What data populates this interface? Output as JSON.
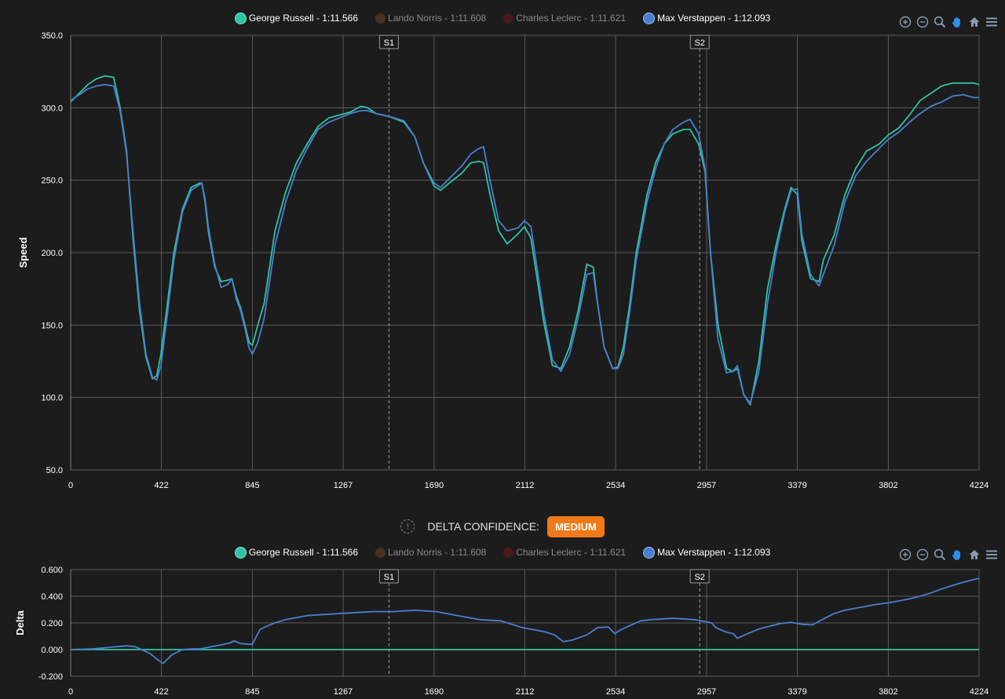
{
  "legend": [
    {
      "label": "George Russell - 1:11.566",
      "color": "#2ec4a5",
      "visible": true
    },
    {
      "label": "Lando Norris - 1:11.608",
      "color": "#5a3a22",
      "visible": false
    },
    {
      "label": "Charles Leclerc - 1:11.621",
      "color": "#5a1e22",
      "visible": false
    },
    {
      "label": "Max Verstappen - 1:12.093",
      "color": "#4a7fd0",
      "visible": true
    }
  ],
  "toolbar": [
    "zoom-in-icon",
    "zoom-out-icon",
    "zoom-selection-icon",
    "pan-icon",
    "home-icon",
    "menu-icon"
  ],
  "delta_confidence": {
    "label": "DELTA CONFIDENCE:",
    "value": "MEDIUM",
    "color": "#f07a1a"
  },
  "chart_data": [
    {
      "type": "line",
      "ylabel": "Speed",
      "xlabel": "",
      "xlim": [
        0,
        4224
      ],
      "ylim": [
        50,
        350
      ],
      "x_ticks": [
        "0",
        "422",
        "845",
        "1267",
        "1690",
        "2112",
        "2534",
        "2957",
        "3379",
        "3802",
        "4224"
      ],
      "y_ticks": [
        "50.0",
        "100.0",
        "150.0",
        "200.0",
        "250.0",
        "300.0",
        "350.0"
      ],
      "grid": true,
      "sector_markers": [
        {
          "label": "S1",
          "x": 1480
        },
        {
          "label": "S2",
          "x": 2925
        }
      ],
      "series": [
        {
          "name": "George Russell - 1:11.566",
          "color": "#2ec4a5",
          "x": [
            0,
            40,
            80,
            120,
            160,
            200,
            230,
            260,
            290,
            320,
            350,
            380,
            400,
            420,
            450,
            480,
            520,
            560,
            600,
            610,
            625,
            640,
            670,
            700,
            730,
            750,
            770,
            790,
            810,
            830,
            845,
            870,
            900,
            950,
            1000,
            1050,
            1100,
            1150,
            1200,
            1250,
            1300,
            1350,
            1380,
            1420,
            1480,
            1550,
            1600,
            1640,
            1690,
            1720,
            1760,
            1820,
            1860,
            1900,
            1920,
            1950,
            1990,
            2030,
            2080,
            2110,
            2140,
            2200,
            2240,
            2280,
            2320,
            2360,
            2400,
            2430,
            2450,
            2480,
            2520,
            2545,
            2570,
            2600,
            2630,
            2680,
            2720,
            2760,
            2800,
            2850,
            2880,
            2920,
            2950,
            2975,
            3010,
            3050,
            3080,
            3100,
            3130,
            3160,
            3200,
            3240,
            3280,
            3320,
            3350,
            3379,
            3400,
            3440,
            3480,
            3500,
            3550,
            3600,
            3650,
            3700,
            3760,
            3800,
            3850,
            3900,
            3950,
            4000,
            4050,
            4100,
            4150,
            4200,
            4224
          ],
          "y": [
            304,
            310,
            316,
            320,
            322,
            321,
            300,
            270,
            210,
            160,
            128,
            113,
            115,
            130,
            165,
            200,
            230,
            245,
            248,
            248,
            235,
            215,
            190,
            180,
            181,
            182,
            170,
            162,
            150,
            138,
            136,
            150,
            165,
            215,
            242,
            262,
            275,
            287,
            293,
            295,
            297,
            301,
            300,
            296,
            294,
            290,
            280,
            262,
            246,
            243,
            248,
            255,
            262,
            263,
            262,
            240,
            215,
            206,
            213,
            218,
            210,
            152,
            122,
            120,
            135,
            160,
            192,
            190,
            165,
            135,
            120,
            121,
            135,
            165,
            200,
            240,
            262,
            275,
            282,
            285,
            285,
            275,
            256,
            200,
            150,
            120,
            118,
            120,
            102,
            95,
            125,
            175,
            205,
            230,
            245,
            240,
            208,
            182,
            180,
            195,
            212,
            240,
            258,
            270,
            275,
            281,
            286,
            295,
            305,
            310,
            315,
            317,
            317,
            317,
            316
          ],
          "color_hex": "#2ec4a5"
        },
        {
          "name": "Max Verstappen - 1:12.093",
          "color": "#4a7fd0",
          "x": [
            0,
            40,
            80,
            120,
            160,
            200,
            230,
            260,
            290,
            320,
            350,
            380,
            400,
            420,
            450,
            480,
            520,
            560,
            600,
            610,
            625,
            640,
            670,
            700,
            730,
            750,
            770,
            790,
            810,
            830,
            845,
            870,
            900,
            950,
            1000,
            1050,
            1100,
            1150,
            1200,
            1250,
            1300,
            1350,
            1380,
            1420,
            1480,
            1550,
            1600,
            1640,
            1690,
            1720,
            1760,
            1820,
            1860,
            1900,
            1920,
            1950,
            1990,
            2030,
            2080,
            2110,
            2140,
            2200,
            2240,
            2280,
            2320,
            2360,
            2400,
            2430,
            2450,
            2480,
            2520,
            2545,
            2570,
            2600,
            2630,
            2680,
            2720,
            2760,
            2800,
            2850,
            2880,
            2920,
            2950,
            2975,
            3010,
            3050,
            3080,
            3100,
            3130,
            3160,
            3200,
            3240,
            3280,
            3320,
            3350,
            3379,
            3400,
            3440,
            3480,
            3500,
            3550,
            3600,
            3650,
            3700,
            3760,
            3800,
            3850,
            3900,
            3950,
            4000,
            4050,
            4100,
            4150,
            4200,
            4224
          ],
          "y": [
            305,
            309,
            313,
            315,
            316,
            315,
            298,
            268,
            215,
            165,
            130,
            114,
            112,
            122,
            158,
            195,
            228,
            243,
            247,
            248,
            237,
            218,
            192,
            176,
            178,
            182,
            168,
            160,
            148,
            134,
            130,
            138,
            155,
            205,
            235,
            257,
            272,
            285,
            290,
            293,
            296,
            298,
            298,
            296,
            294,
            291,
            280,
            262,
            248,
            245,
            251,
            260,
            268,
            272,
            273,
            250,
            222,
            215,
            217,
            222,
            218,
            158,
            126,
            118,
            130,
            155,
            185,
            186,
            165,
            135,
            120,
            120,
            130,
            160,
            195,
            235,
            258,
            275,
            285,
            290,
            292,
            282,
            258,
            200,
            140,
            117,
            118,
            122,
            102,
            96,
            118,
            165,
            200,
            228,
            243,
            244,
            213,
            185,
            177,
            185,
            205,
            235,
            253,
            263,
            272,
            278,
            283,
            290,
            296,
            301,
            304,
            308,
            309,
            307,
            307
          ],
          "color_hex": "#4a7fd0"
        }
      ]
    },
    {
      "type": "line",
      "ylabel": "Delta",
      "xlabel": "",
      "xlim": [
        0,
        4224
      ],
      "ylim": [
        -0.2,
        0.6
      ],
      "x_ticks": [
        "0",
        "422",
        "845",
        "1267",
        "1690",
        "2112",
        "2534",
        "2957",
        "3379",
        "3802",
        "4224"
      ],
      "y_ticks": [
        "-0.200",
        "0.000",
        "0.200",
        "0.400",
        "0.600"
      ],
      "grid": true,
      "sector_markers": [
        {
          "label": "S1",
          "x": 1480
        },
        {
          "label": "S2",
          "x": 2925
        }
      ],
      "series": [
        {
          "name": "George Russell - 1:11.566",
          "color": "#2ec4a5",
          "x": [
            0,
            4224
          ],
          "y": [
            0,
            0
          ]
        },
        {
          "name": "Max Verstappen - 1:12.093",
          "color": "#4a7fd0",
          "x": [
            0,
            100,
            200,
            260,
            300,
            330,
            370,
            400,
            430,
            470,
            520,
            560,
            600,
            650,
            700,
            740,
            760,
            790,
            830,
            845,
            880,
            910,
            950,
            1000,
            1100,
            1200,
            1300,
            1400,
            1500,
            1600,
            1700,
            1800,
            1900,
            2000,
            2050,
            2100,
            2150,
            2200,
            2250,
            2290,
            2330,
            2400,
            2450,
            2500,
            2530,
            2560,
            2600,
            2650,
            2700,
            2800,
            2900,
            2950,
            2980,
            3000,
            3050,
            3080,
            3100,
            3150,
            3200,
            3250,
            3300,
            3350,
            3379,
            3400,
            3450,
            3500,
            3550,
            3600,
            3650,
            3700,
            3750,
            3800,
            3850,
            3900,
            3950,
            4000,
            4050,
            4100,
            4150,
            4200,
            4224
          ],
          "y": [
            0,
            0.005,
            0.02,
            0.028,
            0.022,
            0.0,
            -0.03,
            -0.07,
            -0.105,
            -0.04,
            0.0,
            0.005,
            0.005,
            0.02,
            0.035,
            0.05,
            0.065,
            0.045,
            0.04,
            0.04,
            0.15,
            0.175,
            0.2,
            0.225,
            0.255,
            0.265,
            0.275,
            0.285,
            0.285,
            0.295,
            0.285,
            0.255,
            0.225,
            0.215,
            0.19,
            0.165,
            0.15,
            0.135,
            0.11,
            0.06,
            0.07,
            0.11,
            0.165,
            0.17,
            0.12,
            0.15,
            0.18,
            0.215,
            0.225,
            0.235,
            0.225,
            0.21,
            0.2,
            0.165,
            0.13,
            0.12,
            0.085,
            0.12,
            0.155,
            0.175,
            0.195,
            0.205,
            0.195,
            0.19,
            0.185,
            0.23,
            0.27,
            0.295,
            0.31,
            0.325,
            0.34,
            0.35,
            0.365,
            0.38,
            0.4,
            0.425,
            0.455,
            0.48,
            0.505,
            0.525,
            0.535
          ]
        }
      ]
    }
  ]
}
